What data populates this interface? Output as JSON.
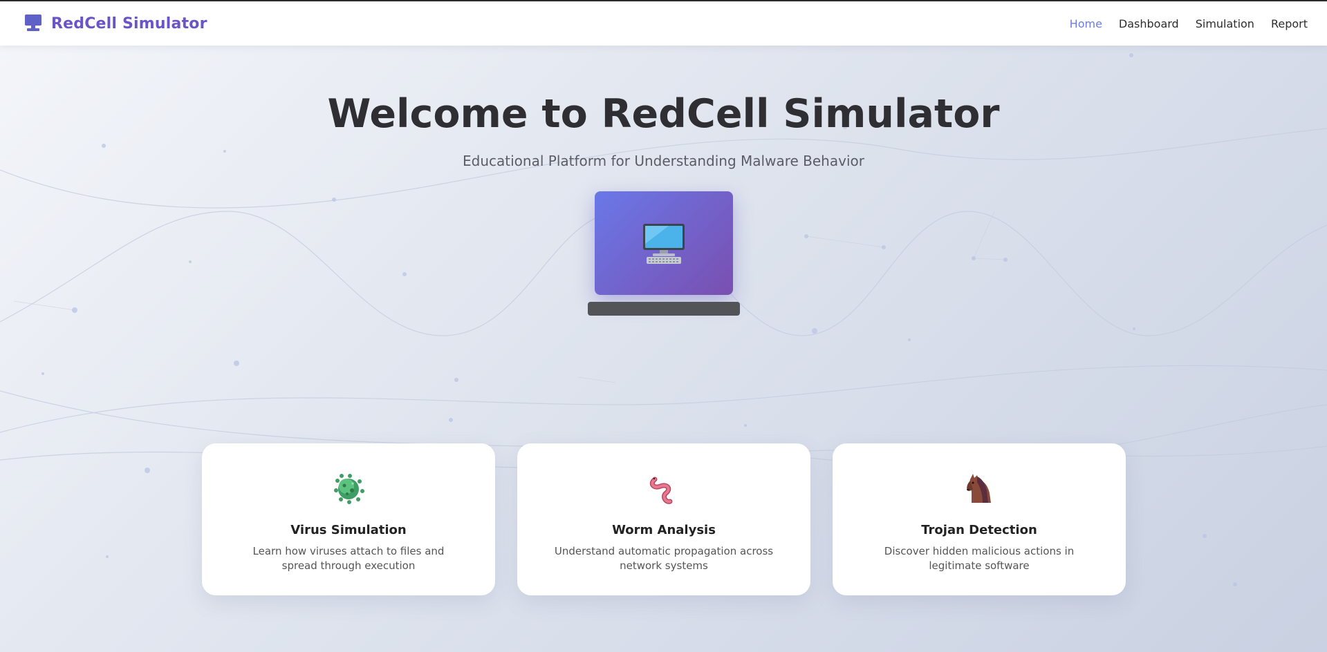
{
  "brand": {
    "name": "RedCell Simulator",
    "icon": "computer-icon"
  },
  "nav": {
    "items": [
      {
        "label": "Home",
        "active": true
      },
      {
        "label": "Dashboard",
        "active": false
      },
      {
        "label": "Simulation",
        "active": false
      },
      {
        "label": "Report",
        "active": false
      }
    ]
  },
  "hero": {
    "title": "Welcome to RedCell Simulator",
    "subtitle": "Educational Platform for Understanding Malware Behavior",
    "icon": "desktop-computer-icon"
  },
  "cards": [
    {
      "icon": "microbe-icon",
      "title": "Virus Simulation",
      "description": "Learn how viruses attach to files and spread through execution"
    },
    {
      "icon": "worm-icon",
      "title": "Worm Analysis",
      "description": "Understand automatic propagation across network systems"
    },
    {
      "icon": "horse-icon",
      "title": "Trojan Detection",
      "description": "Discover hidden malicious actions in legitimate software"
    }
  ],
  "colors": {
    "brand": "#6a55c8",
    "nav_active": "#6d7de2",
    "hero_gradient_start": "#6a78e8",
    "hero_gradient_end": "#7a4fb0"
  }
}
